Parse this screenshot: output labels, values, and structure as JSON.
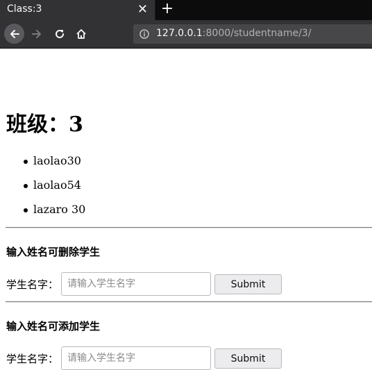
{
  "browser": {
    "tab_title": "Class:3",
    "tab_close": "✕",
    "new_tab": "+",
    "url_host": "127.0.0.1",
    "url_path": ":8000/studentname/3/"
  },
  "page": {
    "heading": "班级：3",
    "students": [
      "laolao30",
      "laolao54",
      "lazaro 30"
    ],
    "delete_form": {
      "title": "输入姓名可删除学生",
      "label": "学生名字：",
      "placeholder": "请输入学生名字",
      "value": "",
      "submit": "Submit"
    },
    "add_form": {
      "title": "输入姓名可添加学生",
      "label": "学生名字：",
      "placeholder": "请输入学生名字",
      "value": "",
      "submit": "Submit"
    }
  },
  "colors": {
    "chrome_dark": "#0c0c0d",
    "chrome_toolbar": "#323234",
    "urlbar": "#474749"
  },
  "icons": [
    "close-icon",
    "plus-icon",
    "back-arrow-icon",
    "forward-arrow-icon",
    "reload-icon",
    "home-icon",
    "info-icon"
  ]
}
